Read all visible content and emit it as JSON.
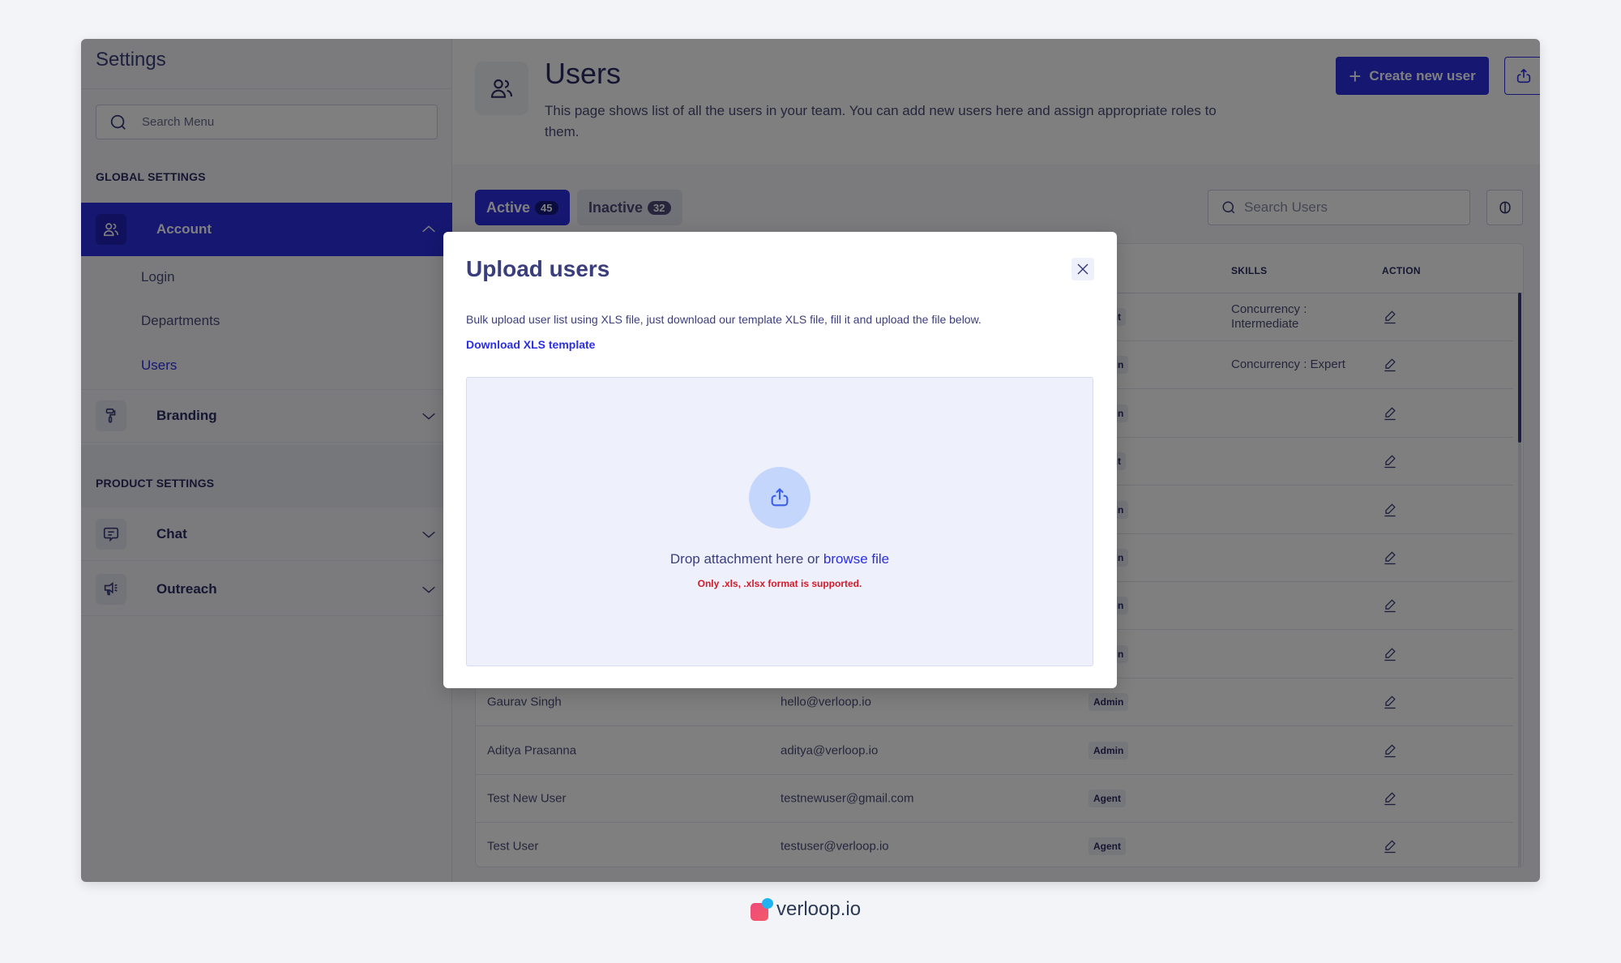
{
  "sidebar": {
    "title": "Settings",
    "search_placeholder": "Search Menu",
    "global_section": "GLOBAL SETTINGS",
    "product_section": "PRODUCT SETTINGS",
    "account": {
      "label": "Account",
      "expanded": true,
      "icon": "users-icon"
    },
    "account_children": [
      {
        "label": "Login"
      },
      {
        "label": "Departments"
      },
      {
        "label": "Users",
        "current": true
      }
    ],
    "branding": {
      "label": "Branding",
      "icon": "paint-roller-icon"
    },
    "chat": {
      "label": "Chat",
      "icon": "chat-bubble-icon"
    },
    "outreach": {
      "label": "Outreach",
      "icon": "megaphone-icon"
    }
  },
  "header": {
    "title": "Users",
    "description": "This page shows list of all the users in your team. You can add new users here and assign appropriate roles to them.",
    "create_button": "Create new user",
    "upload_icon": "upload-icon",
    "download_icon": "download-icon"
  },
  "tabs": [
    {
      "label": "Active",
      "count": "45",
      "active": true
    },
    {
      "label": "Inactive",
      "count": "32",
      "active": false
    }
  ],
  "user_search_placeholder": "Search Users",
  "table": {
    "columns": {
      "skills": "SKILLS",
      "action": "ACTION"
    },
    "rows": [
      {
        "name": "",
        "email": "",
        "role": "Agent",
        "skills": "Concurrency : Intermediate"
      },
      {
        "name": "",
        "email": "",
        "role": "Admin",
        "skills": "Concurrency : Expert"
      },
      {
        "name": "",
        "email": "",
        "role": "Admin",
        "skills": ""
      },
      {
        "name": "",
        "email": "",
        "role": "Agent",
        "skills": ""
      },
      {
        "name": "",
        "email": "",
        "role": "Admin",
        "skills": ""
      },
      {
        "name": "",
        "email": "",
        "role": "Admin",
        "skills": ""
      },
      {
        "name": "",
        "email": "",
        "role": "Admin",
        "skills": ""
      },
      {
        "name": "",
        "email": "",
        "role": "Admin",
        "skills": ""
      },
      {
        "name": "Gaurav Singh",
        "email": "hello@verloop.io",
        "role": "Admin",
        "skills": ""
      },
      {
        "name": "Aditya Prasanna",
        "email": "aditya@verloop.io",
        "role": "Admin",
        "skills": ""
      },
      {
        "name": "Test New User",
        "email": "testnewuser@gmail.com",
        "role": "Agent",
        "skills": ""
      },
      {
        "name": "Test User",
        "email": "testuser@verloop.io",
        "role": "Agent",
        "skills": ""
      }
    ]
  },
  "modal": {
    "title": "Upload users",
    "description": "Bulk upload user list using XLS file, just download our template XLS file, fill it and upload the file below.",
    "download_link": "Download XLS template",
    "drop_text": "Drop attachment here or ",
    "browse_link": "browse file",
    "format_note": "Only .xls, .xlsx format is supported."
  },
  "footer": {
    "brand": "verloop.io"
  },
  "colors": {
    "accent": "#2b2ee2",
    "error": "#d11a2a",
    "dropzone": "#eef1fb"
  }
}
